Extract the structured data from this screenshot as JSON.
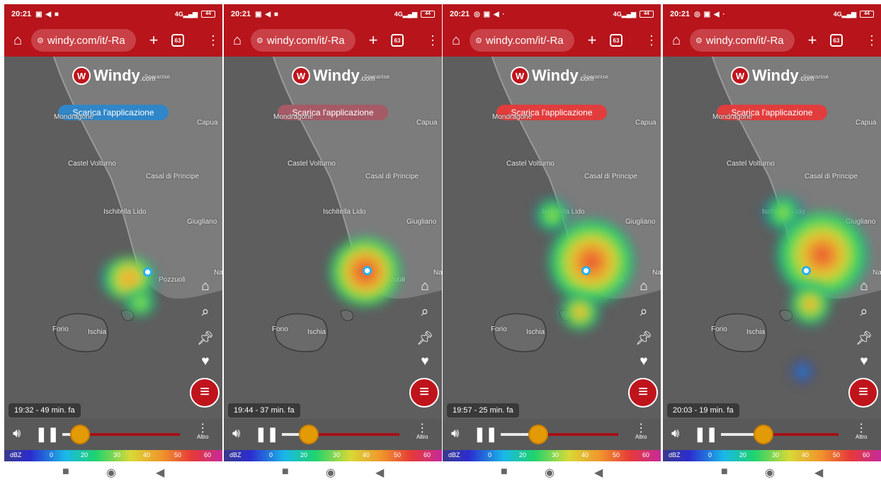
{
  "colors": {
    "toolbar": "#b7141b",
    "accent": "#c0141c",
    "knob": "#e29b06"
  },
  "common": {
    "url": "windy.com/it/-Ra",
    "tab_count": "63",
    "logo_text": "Windy",
    "logo_suffix": ".com",
    "download_label": "Scarica l'applicazione",
    "altro_label": "Altro",
    "scale_unit": "dBZ",
    "scale_ticks": [
      "0",
      "20",
      "30",
      "40",
      "50",
      "60"
    ]
  },
  "places": [
    "Sparanise",
    "Capua",
    "Mondragone",
    "Castel Volturno",
    "Casal di Principe",
    "Ischitella Lido",
    "Giugliano",
    "Pozzuoli",
    "Forio",
    "Ischia",
    "Na"
  ],
  "panels": [
    {
      "status_time": "20:21",
      "status_icons": "▣ ◀ ■",
      "download_color": "#2f86c8",
      "time_label": "19:32 - 49 min. fa",
      "progress": 0.15
    },
    {
      "status_time": "20:21",
      "status_icons": "▣ ◀ ■",
      "download_color": "#a65a66",
      "time_label": "19:44 - 37 min. fa",
      "progress": 0.23
    },
    {
      "status_time": "20:21",
      "status_icons": "◎ ▣ ◀ ·",
      "download_color": "#e23d3d",
      "time_label": "19:57 - 25 min. fa",
      "progress": 0.32
    },
    {
      "status_time": "20:21",
      "status_icons": "◎ ▣ ◀ ·",
      "download_color": "#e23d3d",
      "time_label": "20:03 - 19 min. fa",
      "progress": 0.36
    }
  ]
}
